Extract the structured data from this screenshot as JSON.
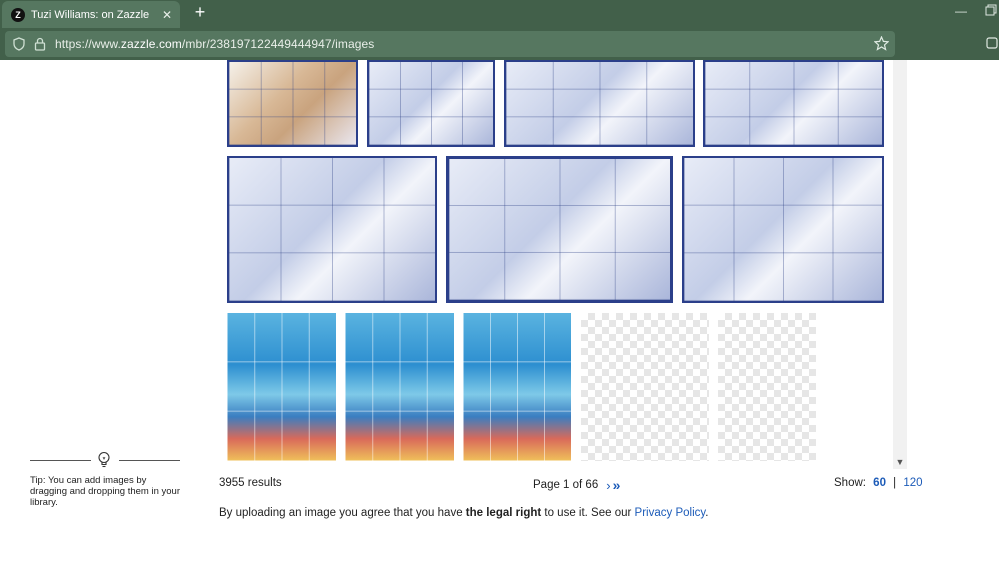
{
  "browser": {
    "tab_title": "Tuzi Williams: on Zazzle",
    "tab_close": "✕",
    "new_tab": "+",
    "url_prefix": "https://www.",
    "url_domain": "zazzle.com",
    "url_path": "/mbr/238197122449444947/images",
    "window_minimize": "—"
  },
  "tip": {
    "text": "Tip: You can add images by dragging and dropping them in your library."
  },
  "results": {
    "count_text": "3955 results"
  },
  "pagination": {
    "label": "Page 1 of 66",
    "next": "›",
    "last": "»"
  },
  "show": {
    "label": "Show:",
    "options": [
      "60",
      "120"
    ],
    "separator": "|"
  },
  "disclaimer": {
    "pre": "By uploading an image you agree that you have ",
    "bold": "the legal right",
    "mid": " to use it. See our ",
    "link": "Privacy Policy",
    "post": "."
  },
  "gallery": [
    {
      "name": "rabbit-tile",
      "style": "blue"
    },
    {
      "name": "puppy-tile",
      "style": "blue"
    },
    {
      "name": "kitten-tile",
      "style": "blue"
    },
    {
      "name": "koi-fish-tile",
      "style": "blue"
    },
    {
      "name": "koi-pair-tile",
      "style": "blue"
    },
    {
      "name": "kittens-window-tile",
      "style": "blue"
    },
    {
      "name": "cow-tile",
      "style": "blue"
    },
    {
      "name": "tropical-fish-tile-1",
      "style": "fish"
    },
    {
      "name": "tropical-fish-tile-2",
      "style": "fish"
    },
    {
      "name": "tropical-fish-tile-3",
      "style": "fish"
    },
    {
      "name": "transparent-tile-1",
      "style": "trans"
    },
    {
      "name": "transparent-tile-2",
      "style": "trans"
    }
  ]
}
